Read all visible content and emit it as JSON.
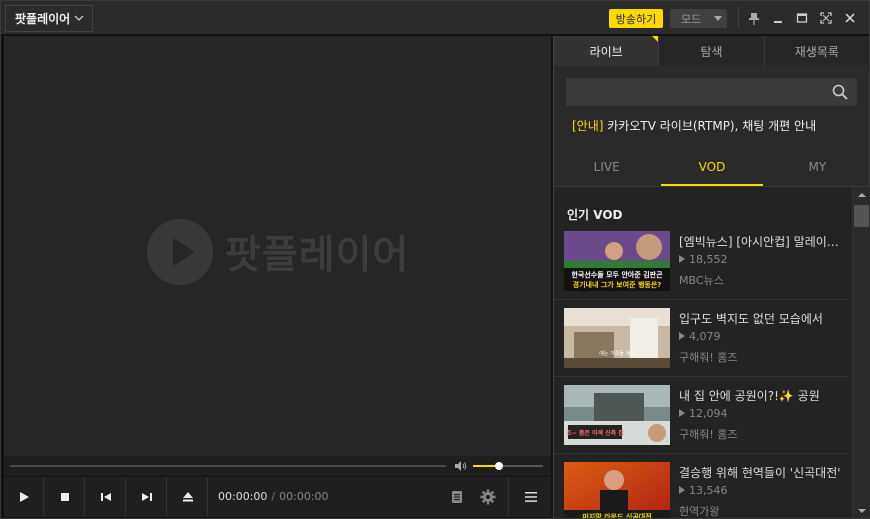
{
  "titlebar": {
    "app_menu_label": "팟플레이어",
    "broadcast_label": "방송하기",
    "mode_label": "모드"
  },
  "player": {
    "brand_text": "팟플레이어",
    "current_time": "00:00:00",
    "time_separator": "/",
    "duration": "00:00:00",
    "volume_level": 0.37
  },
  "sidebar": {
    "tabs": [
      {
        "label": "라이브",
        "active": true
      },
      {
        "label": "탐색",
        "active": false
      },
      {
        "label": "재생목록",
        "active": false
      }
    ],
    "search": {
      "value": "",
      "placeholder": ""
    },
    "notice": {
      "tag": "[안내]",
      "text": " 카카오TV 라이브(RTMP), 채팅 개편 안내"
    },
    "sub_tabs": [
      {
        "label": "LIVE",
        "active": false
      },
      {
        "label": "VOD",
        "active": true
      },
      {
        "label": "MY",
        "active": false
      }
    ],
    "list_heading": "인기 VOD",
    "vod_items": [
      {
        "title": "[엠빅뉴스] [아시안컵] 말레이시아",
        "views": "18,552",
        "channel": "MBC뉴스",
        "thumb_text": "한국선수들 모두 안아준 김판곤\n경기내내 그가 보여준 행동은?"
      },
      {
        "title": "입구도 벽지도 없던 모습에서",
        "views": "4,079",
        "channel": "구해줘! 홈즈",
        "thumb_text": "에는 가족들 새라"
      },
      {
        "title": "내 집 안에 공원이?!✨ 공원",
        "views": "12,094",
        "channel": "구해줘! 홈즈",
        "thumb_text": "조~ 품은 이색 신축 집"
      },
      {
        "title": "결승행 위해 현역들이 '신곡대전'",
        "views": "13,546",
        "channel": "현역가왕",
        "thumb_text": "마지막 라운드 신곡대전"
      }
    ]
  }
}
